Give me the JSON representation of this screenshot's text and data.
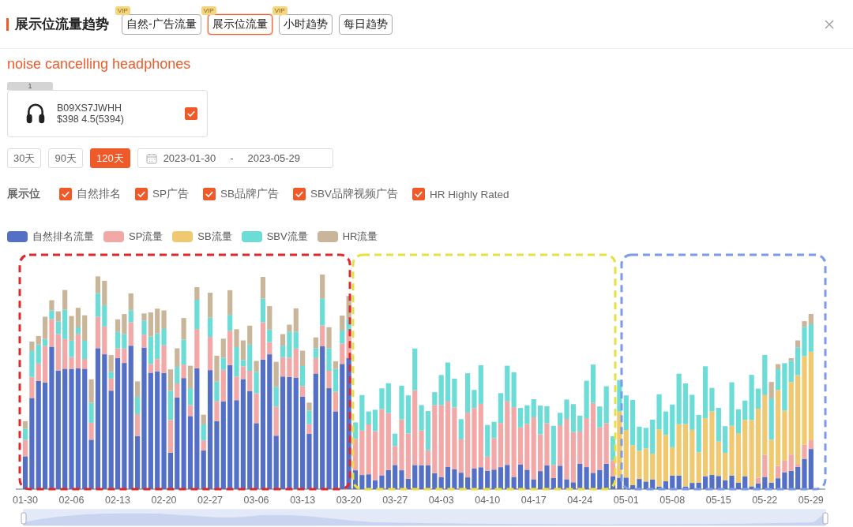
{
  "header": {
    "title": "展示位流量趋势"
  },
  "tabs": [
    {
      "label": "自然-广告流量",
      "badge": "VIP",
      "selected": false
    },
    {
      "label": "展示位流量",
      "badge": "VIP",
      "selected": true
    },
    {
      "label": "小时趋势",
      "badge": "VIP",
      "selected": false
    },
    {
      "label": "每日趋势",
      "selected": false
    }
  ],
  "keyword": "noise cancelling headphones",
  "products": [
    {
      "index": "1",
      "asin": "B09XS7JWHH",
      "price_rating": "$398 4.5(5394)",
      "checked": true
    }
  ],
  "periods": [
    {
      "label": "30天",
      "selected": false
    },
    {
      "label": "90天",
      "selected": false
    },
    {
      "label": "120天",
      "selected": true
    }
  ],
  "date_range": {
    "start": "2023-01-30",
    "separator": "-",
    "end": "2023-05-29"
  },
  "placements": {
    "label": "展示位",
    "options": [
      {
        "label": "自然排名",
        "checked": true
      },
      {
        "label": "SP广告",
        "checked": true
      },
      {
        "label": "SB品牌广告",
        "checked": true
      },
      {
        "label": "SBV品牌视频广告",
        "checked": true
      },
      {
        "label": "HR Highly Rated",
        "checked": true
      }
    ]
  },
  "legend": [
    {
      "name": "自然排名流量",
      "color": "#5470c6"
    },
    {
      "name": "SP流量",
      "color": "#f3a8a8"
    },
    {
      "name": "SB流量",
      "color": "#f0c870"
    },
    {
      "name": "SBV流量",
      "color": "#6cdcd6"
    },
    {
      "name": "HR流量",
      "color": "#c9b59a"
    }
  ],
  "zoom_window": {
    "level": 1
  },
  "x_labels": [
    "01-30",
    "02-06",
    "02-13",
    "02-20",
    "02-27",
    "03-06",
    "03-13",
    "03-20",
    "03-27",
    "04-03",
    "04-10",
    "04-17",
    "04-24",
    "05-01",
    "05-08",
    "05-15",
    "05-22",
    "05-29"
  ]
}
